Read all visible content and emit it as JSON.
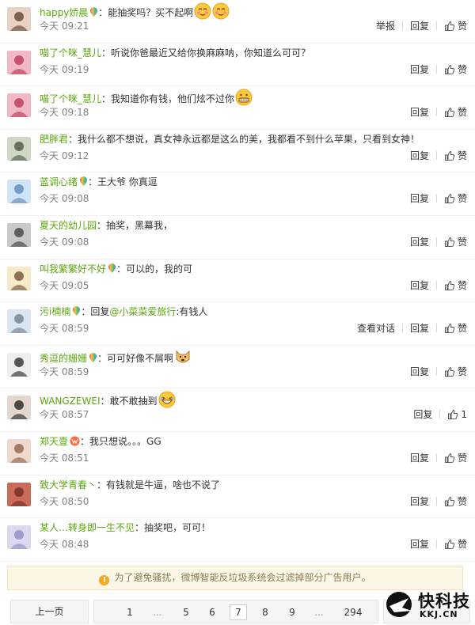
{
  "comments": [
    {
      "user": "happy娇晨",
      "badge": true,
      "text": "：能抽奖吗？买不起啊",
      "emoji": "blush2",
      "time": "今天 09:21",
      "report": "举报",
      "reply": "回复",
      "like": "赞"
    },
    {
      "user": "喵了个咪_慧儿",
      "badge": false,
      "text": "：听说你爸最近又给你换麻麻呐，你知道么可可？",
      "emoji": "",
      "time": "今天 09:19",
      "reply": "回复",
      "like": "赞"
    },
    {
      "user": "喵了个咪_慧儿",
      "badge": false,
      "text": "：我知道你有钱，他们炫不过你",
      "emoji": "grin",
      "time": "今天 09:18",
      "reply": "回复",
      "like": "赞"
    },
    {
      "user": "肥胖君",
      "badge": false,
      "text": "：我什么都不想说，真女神永远都是这么的美，我都看不到什么苹果，只看到女神！",
      "emoji": "",
      "time": "今天 09:12",
      "reply": "回复",
      "like": "赞"
    },
    {
      "user": "蓝调心绪",
      "badge": true,
      "text": "：王大爷 你真逗",
      "emoji": "",
      "time": "今天 09:08",
      "reply": "回复",
      "like": "赞"
    },
    {
      "user": "夏天的幼儿园",
      "badge": false,
      "text": "：抽奖，黑幕我，",
      "emoji": "",
      "time": "今天 09:08",
      "reply": "回复",
      "like": "赞"
    },
    {
      "user": "叫我繁繁好不好",
      "badge": true,
      "text": "：可以的，我的可",
      "emoji": "",
      "time": "今天 09:05",
      "reply": "回复",
      "like": "赞"
    },
    {
      "user": "污i楠楠",
      "badge": true,
      "text_pre": "：回复",
      "mention": "@小菜菜爱旅行",
      "text": ":有钱人",
      "emoji": "",
      "time": "今天 08:59",
      "view_conv": "查看对话",
      "reply": "回复",
      "like": "赞"
    },
    {
      "user": "秀逗的姗姗",
      "badge": true,
      "text": "：可可好像不屑啊",
      "emoji": "doge",
      "time": "今天 08:59",
      "reply": "回复",
      "like": "赞"
    },
    {
      "user": "WANGZEWEI",
      "badge": false,
      "text": "：敢不敢抽到",
      "emoji": "laugh",
      "time": "今天 08:57",
      "reply": "回复",
      "like": "1"
    },
    {
      "user": "郑天壹",
      "badge": false,
      "vip": true,
      "text": "：我只想说。。。GG",
      "emoji": "",
      "time": "今天 08:51",
      "reply": "回复",
      "like": "赞"
    },
    {
      "user": "致大学青春丶",
      "badge": false,
      "text": "：有钱就是牛逼，啥也不说了",
      "emoji": "",
      "time": "今天 08:50",
      "reply": "回复",
      "like": "赞"
    },
    {
      "user": "某人…转身即一生不见",
      "badge": false,
      "text": "：抽奖吧，可可！",
      "emoji": "",
      "time": "今天 08:48",
      "reply": "回复",
      "like": "赞"
    }
  ],
  "notice": "为了避免骚扰，微博智能反垃圾系统会过滤掉部分广告用户。",
  "pagination": {
    "prev": "上一页",
    "pages": [
      "1",
      "...",
      "5",
      "6",
      "7",
      "8",
      "9",
      "...",
      "294"
    ],
    "current": "7"
  },
  "watermark": {
    "title": "快科技",
    "sub": "KKJ.CN"
  },
  "colors": {
    "username": "#5aa80c",
    "time": "#808080",
    "notice_bg": "#fdf7e8"
  }
}
